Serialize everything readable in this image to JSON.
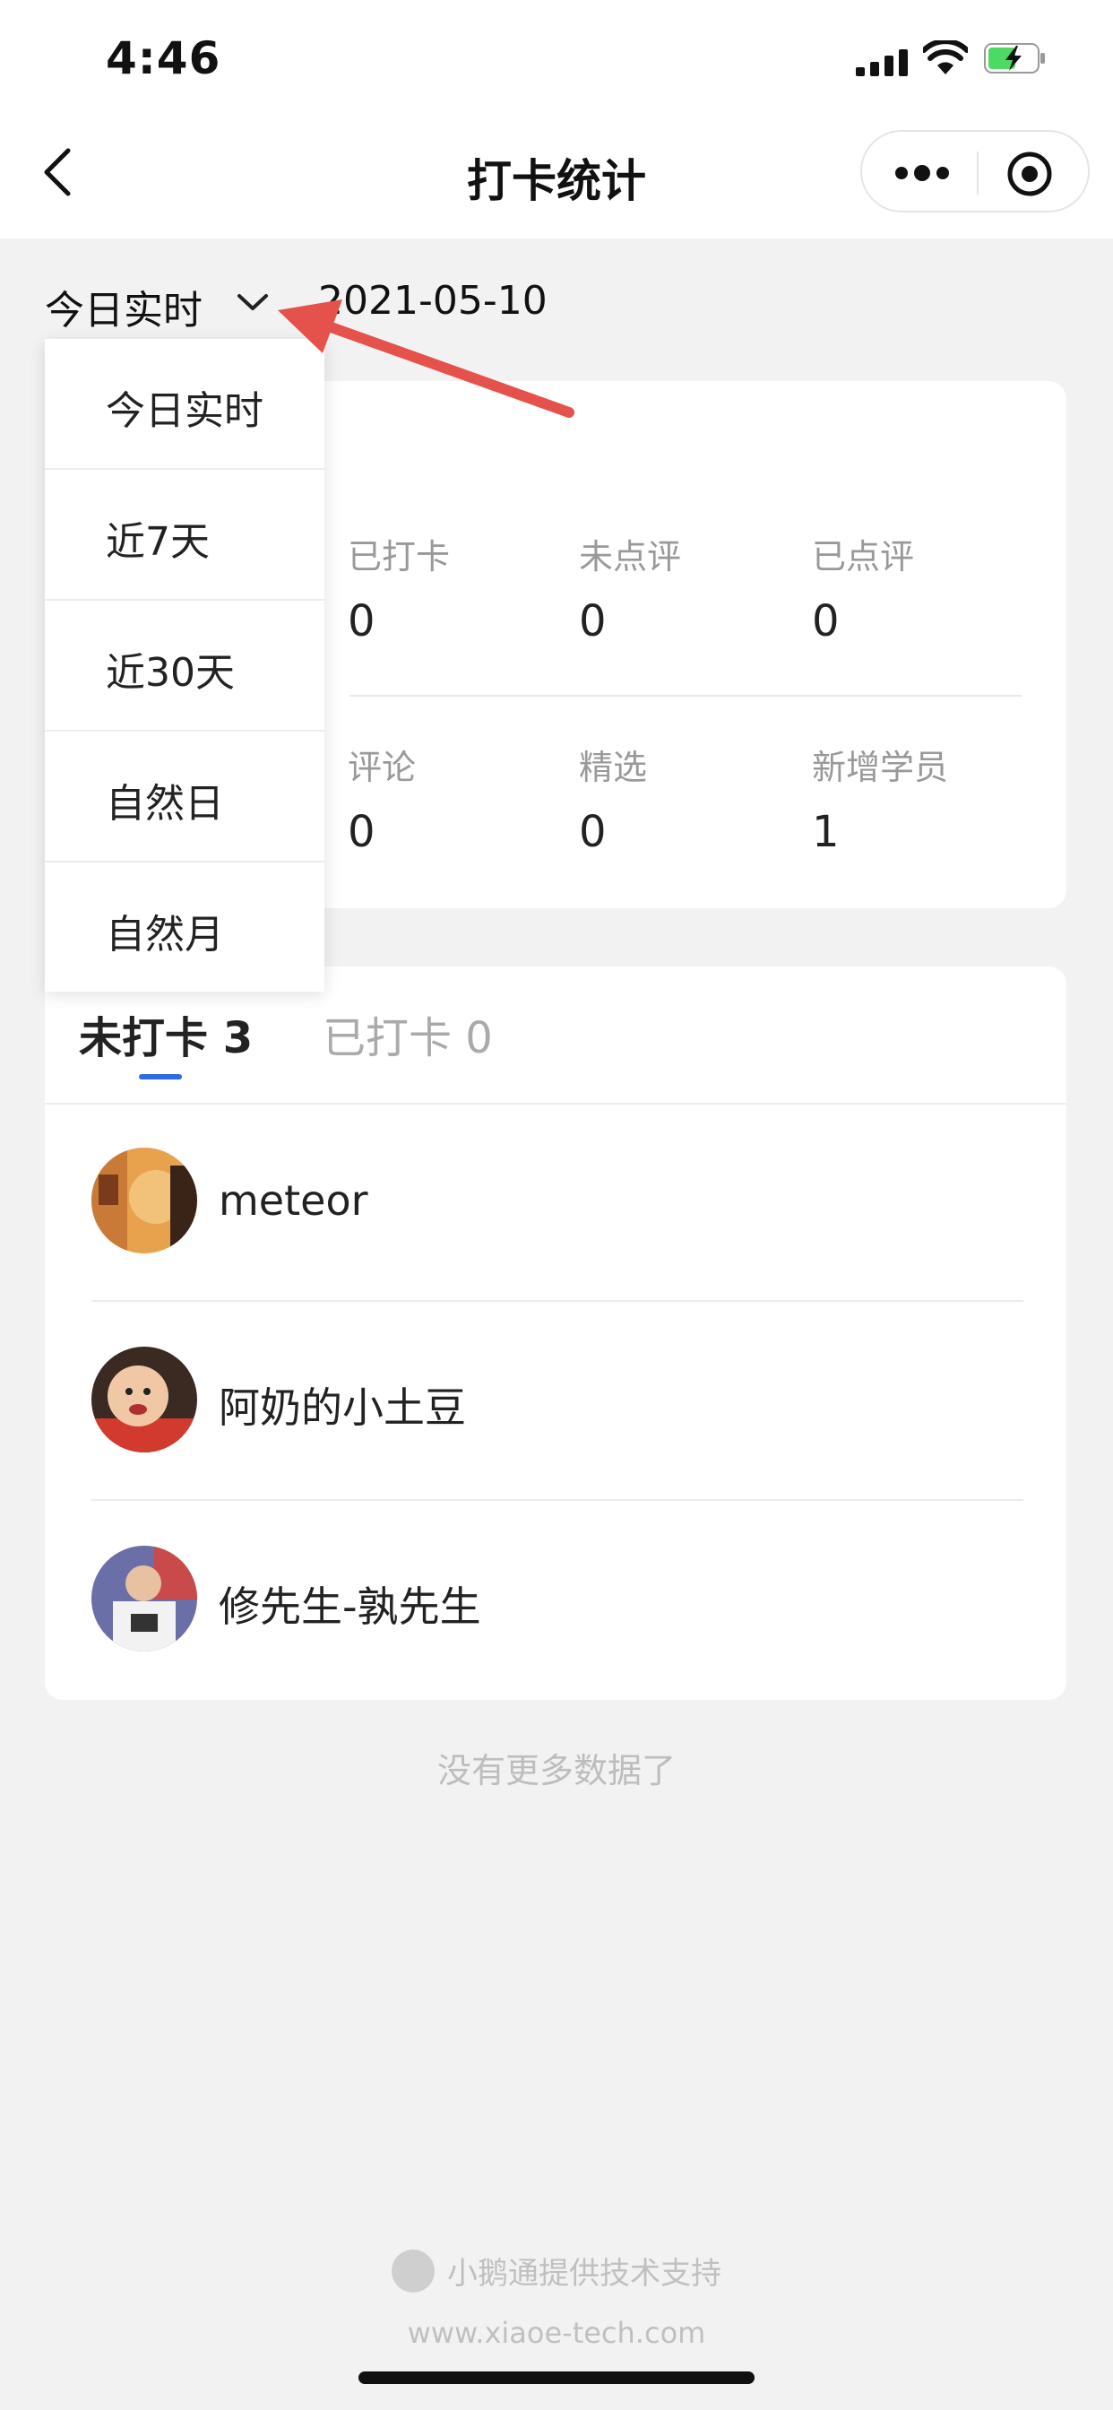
{
  "status_bar": {
    "time": "4:46"
  },
  "nav": {
    "title": "打卡统计"
  },
  "filter": {
    "selected": "今日实时",
    "date": "2021-05-10"
  },
  "stats": [
    {
      "label": "已打卡",
      "value": "0"
    },
    {
      "label": "未点评",
      "value": "0"
    },
    {
      "label": "已点评",
      "value": "0"
    },
    {
      "label": "评论",
      "value": "0"
    },
    {
      "label": "精选",
      "value": "0"
    },
    {
      "label": "新增学员",
      "value": "1"
    }
  ],
  "tabs": [
    {
      "label": "未打卡 3",
      "active": true
    },
    {
      "label": "已打卡 0",
      "active": false
    }
  ],
  "users": [
    {
      "name": "meteor"
    },
    {
      "name": "阿奶的小土豆"
    },
    {
      "name": "修先生-孰先生"
    }
  ],
  "no_more": "没有更多数据了",
  "dropdown": [
    "今日实时",
    "近7天",
    "近30天",
    "自然日",
    "自然月"
  ],
  "footer": {
    "line1": "小鹅通提供技术支持",
    "line2": "www.xiaoe-tech.com"
  },
  "colors": {
    "accent": "#2d6be0",
    "arrow": "#e5514b"
  }
}
